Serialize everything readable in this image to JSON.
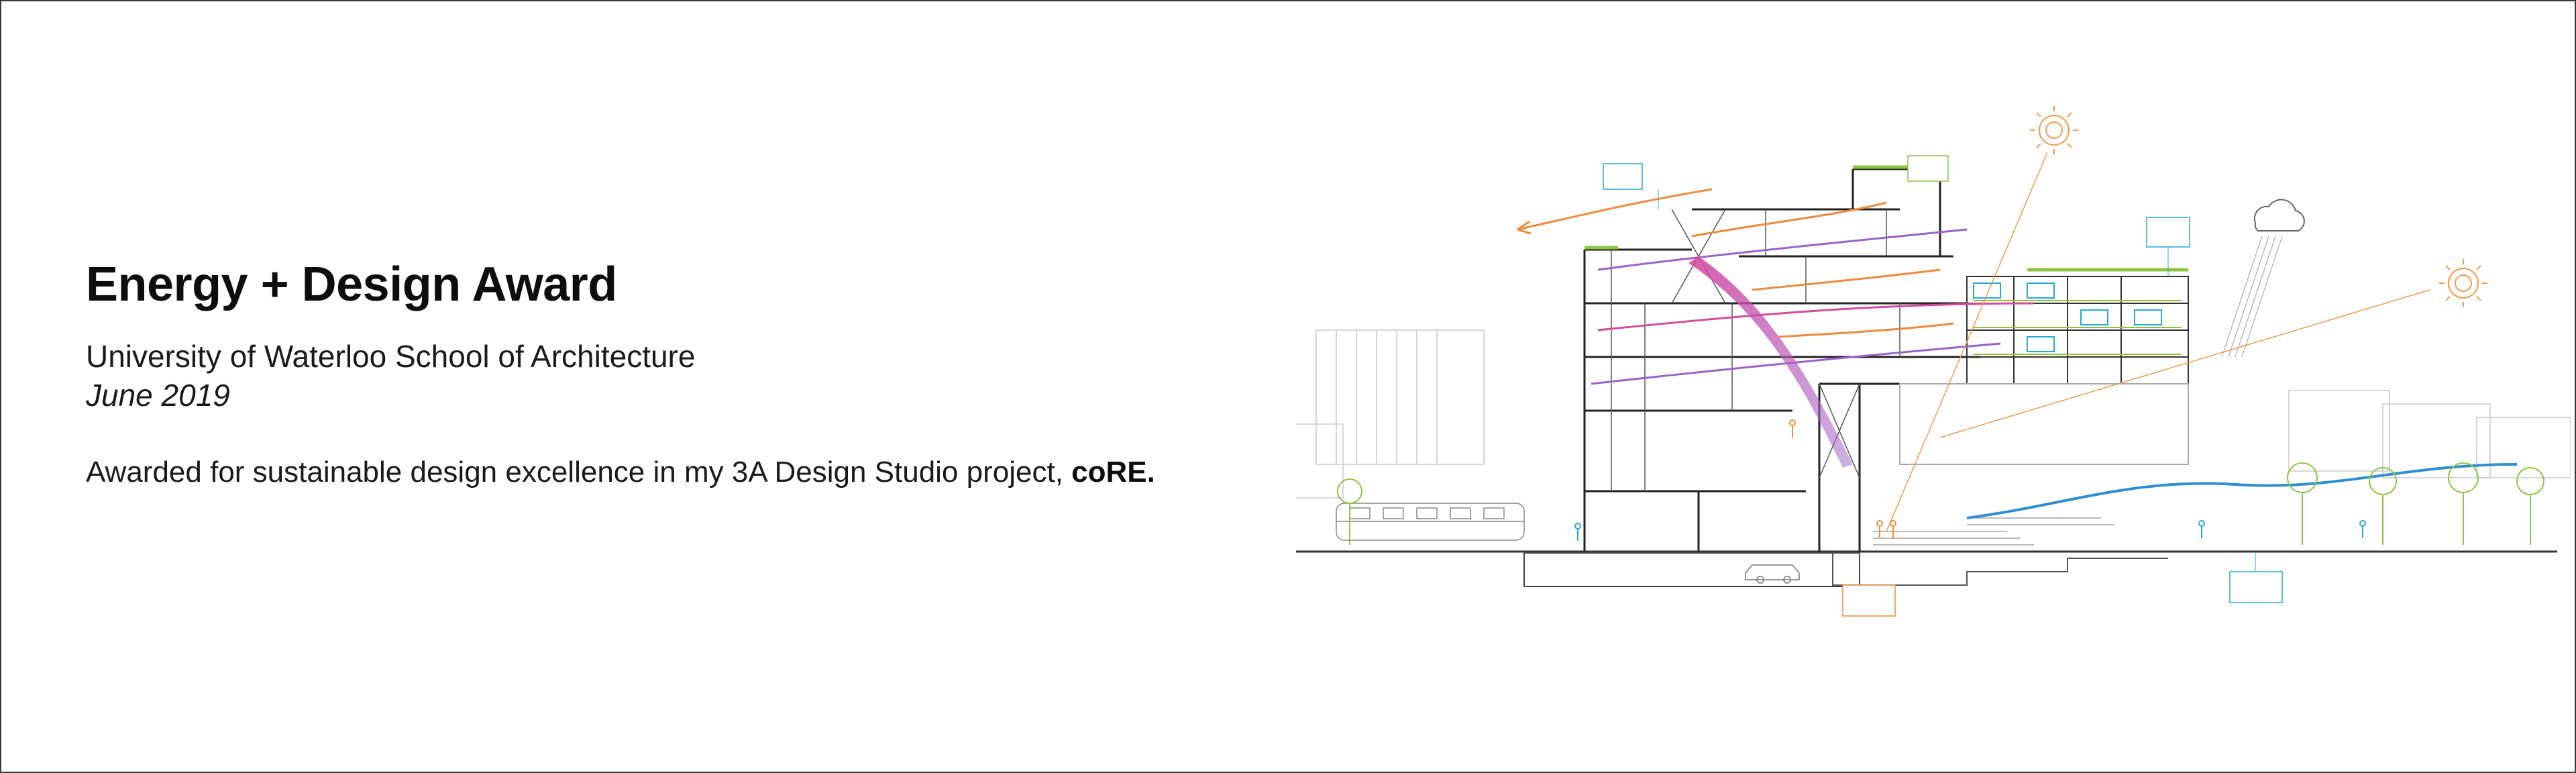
{
  "award": {
    "title": "Energy + Design Award",
    "institution": "University of Waterloo School of Architecture",
    "date": "June 2019",
    "description_prefix": "Awarded for sustainable design excellence in my 3A Design Studio project, ",
    "project_name": "coRE."
  },
  "colors": {
    "background": "#ffffff",
    "frame": "#3a3a3a",
    "text": "#111111",
    "ventilation_orange": "#f08a3c",
    "heat_magenta": "#d64aa0",
    "air_purple": "#9b62c9",
    "water_blue": "#2f8fd0",
    "green_roof": "#8cc63f",
    "annotation_cyan": "#26a9d6",
    "sun_orange": "#f29a4a"
  },
  "drawing": {
    "type": "sectional-perspective-diagram",
    "icons": [
      "sun-icon",
      "moon-icon",
      "cloud-icon",
      "rain-icon",
      "train-icon",
      "person-icon",
      "tree-icon",
      "car-icon"
    ]
  }
}
